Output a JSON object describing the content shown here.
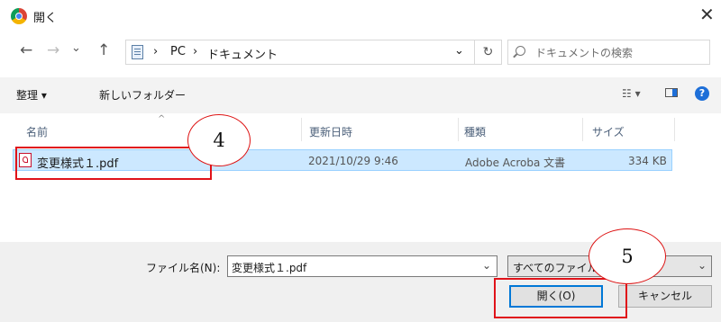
{
  "window": {
    "title": "開く",
    "close_glyph": "✕"
  },
  "nav": {
    "back": "←",
    "forward": "→",
    "recent": "⌄",
    "up": "↑"
  },
  "address": {
    "sep1": "›",
    "crumb_pc": "PC",
    "sep2": "›",
    "crumb_docs": "ドキュメント",
    "dropdown": "⌄",
    "refresh": "↻"
  },
  "search": {
    "placeholder": "ドキュメントの検索"
  },
  "command_bar": {
    "organize": "整理 ▾",
    "new_folder": "新しいフォルダー",
    "view": "☷ ▾",
    "help": "?"
  },
  "columns": {
    "name": "名前",
    "sort_arrow": "^",
    "modified": "更新日時",
    "type": "種類",
    "size": "サイズ"
  },
  "files": [
    {
      "name": "変更様式１.pdf",
      "modified": "2021/10/29 9:46",
      "type": "Adobe Acroba 文書",
      "size": "334 KB"
    }
  ],
  "bottom": {
    "filename_label": "ファイル名(N):",
    "filename_value": "変更様式１.pdf",
    "filename_dropdown": "⌄",
    "filetype_value": "すべてのファイル",
    "filetype_dropdown": "⌄",
    "open_button": "開く(O)",
    "cancel_button": "キャンセル"
  },
  "annotations": {
    "step4": "4",
    "step5": "5"
  },
  "colors": {
    "selection": "#cce8ff",
    "annotation": "#e0131a",
    "help": "#1e6fd8"
  }
}
